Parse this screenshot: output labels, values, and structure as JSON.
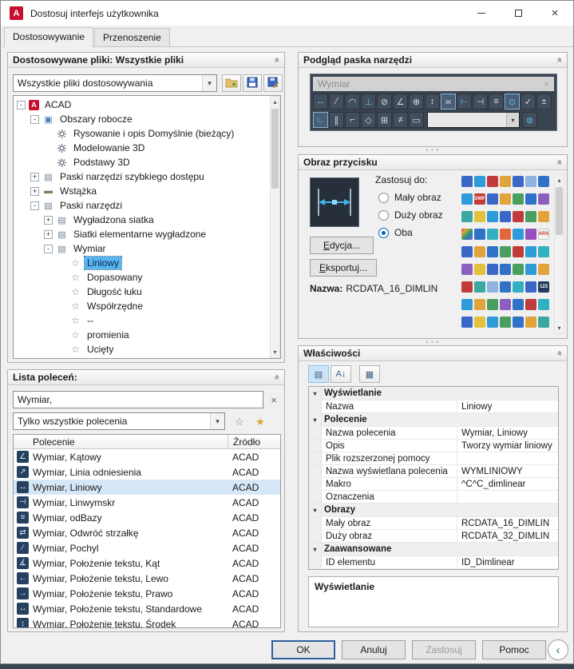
{
  "decor": {
    "close": "×",
    "combo_arrow": "▾",
    "scroll_up": "▴",
    "scroll_down": "▾",
    "splitter": "• • •",
    "collapse_chevron": "»",
    "circle_chevron": "‹",
    "category_marker": "▾",
    "star_outline": "☆",
    "star_filled": "★"
  },
  "titlebar": {
    "title": "Dostosuj interfejs użytkownika",
    "app_letter": "A"
  },
  "tabs": [
    {
      "label": "Dostosowywanie",
      "active": true
    },
    {
      "label": "Przenoszenie",
      "active": false
    }
  ],
  "files_panel": {
    "title": "Dostosowywane pliki: Wszystkie pliki",
    "combo_value": "Wszystkie pliki dostosowywania",
    "tree": [
      {
        "level": 0,
        "expander": "-",
        "icon": "acad",
        "label": "ACAD"
      },
      {
        "level": 1,
        "expander": "-",
        "icon": "workspace",
        "label": "Obszary robocze"
      },
      {
        "level": 2,
        "expander": "",
        "icon": "gear",
        "label": "Rysowanie i opis Domyślnie (bieżący)"
      },
      {
        "level": 2,
        "expander": "",
        "icon": "gear",
        "label": "Modelowanie 3D"
      },
      {
        "level": 2,
        "expander": "",
        "icon": "gear",
        "label": "Podstawy 3D"
      },
      {
        "level": 1,
        "expander": "+",
        "icon": "toolbar",
        "label": "Paski narzędzi szybkiego dostępu"
      },
      {
        "level": 1,
        "expander": "+",
        "icon": "ribbon",
        "label": "Wstążka"
      },
      {
        "level": 1,
        "expander": "-",
        "icon": "toolbar",
        "label": "Paski narzędzi"
      },
      {
        "level": 2,
        "expander": "+",
        "icon": "toolbar",
        "label": "Wygładzona siatka"
      },
      {
        "level": 2,
        "expander": "+",
        "icon": "toolbar",
        "label": "Siatki elementarne wygładzone"
      },
      {
        "level": 2,
        "expander": "-",
        "icon": "toolbar",
        "label": "Wymiar"
      },
      {
        "level": 3,
        "expander": "",
        "icon": "star",
        "label": "Liniowy",
        "selected": true
      },
      {
        "level": 3,
        "expander": "",
        "icon": "star",
        "label": "Dopasowany"
      },
      {
        "level": 3,
        "expander": "",
        "icon": "star",
        "label": "Długość łuku"
      },
      {
        "level": 3,
        "expander": "",
        "icon": "star",
        "label": "Współrzędne"
      },
      {
        "level": 3,
        "expander": "",
        "icon": "star",
        "label": "--"
      },
      {
        "level": 3,
        "expander": "",
        "icon": "star",
        "label": "promienia"
      },
      {
        "level": 3,
        "expander": "",
        "icon": "star",
        "label": "Ucięty"
      }
    ]
  },
  "command_panel": {
    "title": "Lista poleceń:",
    "search_value": "Wymiar,",
    "filter_value": "Tylko wszystkie polecenia",
    "columns": [
      "Polecenie",
      "Źródło"
    ],
    "rows": [
      {
        "glyph": "∠",
        "command": "Wymiar, Kątowy",
        "source": "ACAD"
      },
      {
        "glyph": "↗",
        "command": "Wymiar, Linia odniesienia",
        "source": "ACAD"
      },
      {
        "glyph": "↔",
        "command": "Wymiar, Liniowy",
        "source": "ACAD",
        "selected": true
      },
      {
        "glyph": "⊣",
        "command": "Wymiar, Linwymskr",
        "source": "ACAD"
      },
      {
        "glyph": "≡",
        "command": "Wymiar, odBazy",
        "source": "ACAD"
      },
      {
        "glyph": "⇄",
        "command": "Wymiar, Odwróć strzałkę",
        "source": "ACAD"
      },
      {
        "glyph": "∕",
        "command": "Wymiar, Pochyl",
        "source": "ACAD"
      },
      {
        "glyph": "∡",
        "command": "Wymiar, Położenie tekstu, Kąt",
        "source": "ACAD"
      },
      {
        "glyph": "←",
        "command": "Wymiar, Położenie tekstu, Lewo",
        "source": "ACAD"
      },
      {
        "glyph": "→",
        "command": "Wymiar, Położenie tekstu, Prawo",
        "source": "ACAD"
      },
      {
        "glyph": "↔",
        "command": "Wymiar, Położenie tekstu, Standardowe",
        "source": "ACAD"
      },
      {
        "glyph": "↕",
        "command": "Wymiar, Położenie tekstu, Środek",
        "source": "ACAD"
      }
    ]
  },
  "preview_panel": {
    "title": "Podgląd paska narzędzi",
    "toolbar_title": "Wymiar",
    "row1": [
      {
        "g": "↔",
        "cyan": true
      },
      {
        "g": "∕"
      },
      {
        "g": "◠"
      },
      {
        "g": "⊥",
        "cyan": true
      },
      {
        "g": "⊘"
      },
      {
        "g": "∠"
      },
      {
        "g": "⊕"
      },
      {
        "g": "↕"
      },
      {
        "g": "≍",
        "hl": true
      },
      {
        "g": "⊢",
        "cyan": true
      },
      {
        "g": "⊣"
      },
      {
        "g": "≡"
      },
      {
        "g": "⊙",
        "cyan": true,
        "hl": true
      },
      {
        "g": "✓"
      },
      {
        "g": "±"
      }
    ],
    "row2": [
      {
        "g": "∟",
        "cyan": true,
        "hl": true
      },
      {
        "g": "∥"
      },
      {
        "g": "⌐"
      },
      {
        "g": "◇"
      },
      {
        "g": "⊞"
      },
      {
        "g": "≠"
      },
      {
        "g": "▭"
      }
    ],
    "row2_tail": [
      {
        "g": "⊚",
        "cyan": true
      }
    ]
  },
  "button_image_panel": {
    "title": "Obraz przycisku",
    "apply_label": "Zastosuj do:",
    "options": [
      {
        "label": "Mały obraz",
        "checked": false
      },
      {
        "label": "Duży obraz",
        "checked": false
      },
      {
        "label": "Oba",
        "checked": true
      }
    ],
    "edit_label": "Edycja...",
    "export_label": "Eksportuj...",
    "name_label": "Nazwa:",
    "name_value": "RCDATA_16_DIMLIN",
    "grid_icons": [
      "#3a66c8",
      "#2f9bd8",
      "#c23b3b",
      "#e2a33c",
      "#3a66c8",
      "#8fb3e0",
      "#2f72c8",
      "#2f9bd8",
      "#c23b3b|DWF",
      "#3a66c8",
      "#e2a33c",
      "#4a9e5f",
      "#2f72c8",
      "#8a5fc0",
      "#3aa7a0",
      "#e2c23c",
      "#2f9bd8",
      "#3a66c8",
      "#c23b3b",
      "#4a9e5f",
      "#e2a33c",
      "rainbow",
      "#2f72c8",
      "#30b0c0",
      "#e2673c",
      "#2f9bd8",
      "#9a4fc0",
      "#f2f2f2|ARX",
      "#3a66c8",
      "#e2a33c",
      "#2f72c8",
      "#4a9e5f",
      "#c23b3b",
      "#2f9bd8",
      "#30b0c0",
      "#8a5fc0",
      "#e2c23c",
      "#3a66c8",
      "#2f72c8",
      "#4a9e5f",
      "#2f9bd8",
      "#e2a33c",
      "#c23b3b",
      "#3aa7a0",
      "#8fb3e0",
      "#2f72c8",
      "#30b0c0",
      "#3a66c8",
      "#203a60|123",
      "#2f9bd8",
      "#e2a33c",
      "#4a9e5f",
      "#8a5fc0",
      "#2f72c8",
      "#c23b3b",
      "#30b0c0",
      "#3a66c8",
      "#e2c23c",
      "#2f9bd8",
      "#4a9e5f",
      "#2f72c8",
      "#e2a33c",
      "#3aa7a0"
    ]
  },
  "properties_panel": {
    "title": "Właściwości",
    "toolbar": [
      {
        "name": "categorized-button",
        "glyph": "▤",
        "pressed": true
      },
      {
        "name": "alphabetical-sort-button",
        "glyph": "A↓"
      },
      {
        "name": "property-page-button",
        "glyph": "▦",
        "sep": true
      }
    ],
    "groups": [
      {
        "name": "Wyświetlanie",
        "rows": [
          {
            "k": "Nazwa",
            "v": "Liniowy"
          }
        ]
      },
      {
        "name": "Polecenie",
        "rows": [
          {
            "k": "Nazwa polecenia",
            "v": "Wymiar, Liniowy"
          },
          {
            "k": "Opis",
            "v": "Tworzy wymiar liniowy"
          },
          {
            "k": "Plik rozszerzonej pomocy",
            "v": ""
          },
          {
            "k": "Nazwa wyświetlana polecenia",
            "v": "WYMLINIOWY"
          },
          {
            "k": "Makro",
            "v": "^C^C_dimlinear"
          },
          {
            "k": "Oznaczenia",
            "v": ""
          }
        ]
      },
      {
        "name": "Obrazy",
        "rows": [
          {
            "k": "Mały obraz",
            "v": "RCDATA_16_DIMLIN"
          },
          {
            "k": "Duży obraz",
            "v": "RCDATA_32_DIMLIN"
          }
        ]
      },
      {
        "name": "Zaawansowane",
        "rows": [
          {
            "k": "ID elementu",
            "v": "ID_Dimlinear"
          }
        ]
      }
    ],
    "description_title": "Wyświetlanie"
  },
  "footer": {
    "ok": "OK",
    "cancel": "Anuluj",
    "apply": "Zastosuj",
    "help": "Pomoc"
  }
}
